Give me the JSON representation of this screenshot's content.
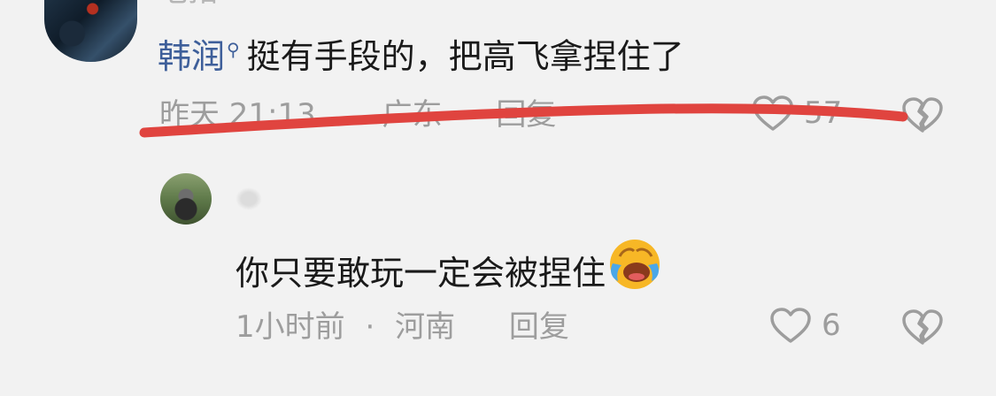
{
  "top_partial_name": "毛拓",
  "comment1": {
    "username": "韩润",
    "text": "挺有手段的，把高飞拿捏住了",
    "time": "昨天 21:13",
    "location": "广东",
    "reply_label": "回复",
    "likes": "57"
  },
  "comment2": {
    "text": "你只要敢玩一定会被捏住",
    "time": "1小时前",
    "separator": "·",
    "location": "河南",
    "reply_label": "回复",
    "likes": "6"
  },
  "icons": {
    "verified": "search-badge-icon",
    "like": "heart-icon",
    "dislike": "broken-heart-icon",
    "emoji": "laughing-crying-emoji"
  },
  "colors": {
    "background": "#f2f2f2",
    "username": "#3e5f9a",
    "meta": "#9d9d9d",
    "strike": "#e0443f"
  }
}
